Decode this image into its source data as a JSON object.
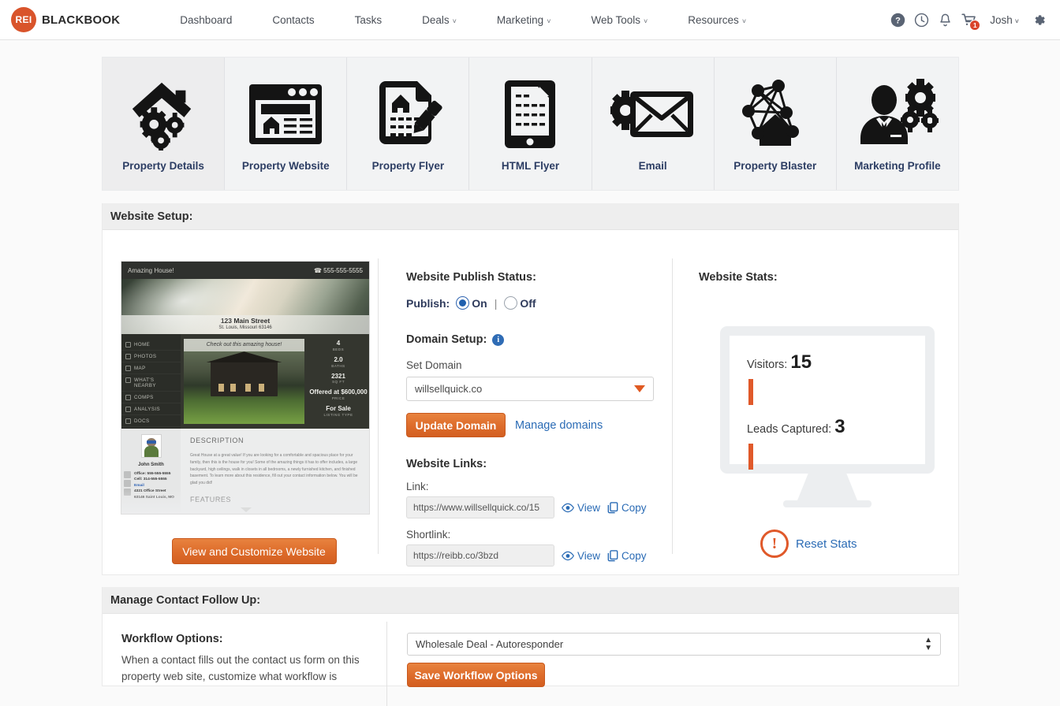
{
  "brand": {
    "badge": "REI",
    "name": "BLACKBOOK",
    "badge_color": "#d9542b"
  },
  "nav": {
    "links": [
      {
        "label": "Dashboard",
        "caret": ""
      },
      {
        "label": "Contacts",
        "caret": ""
      },
      {
        "label": "Tasks",
        "caret": ""
      },
      {
        "label": "Deals",
        "caret": "˅"
      },
      {
        "label": "Marketing",
        "caret": "˅"
      },
      {
        "label": "Web Tools",
        "caret": "˅"
      },
      {
        "label": "Resources",
        "caret": "˅"
      }
    ],
    "icons": [
      "help-icon",
      "history-clock-icon",
      "notification-bell-icon",
      "shopping-cart-icon",
      "settings-gear-icon"
    ],
    "cart_count": "1",
    "user": "Josh",
    "user_caret": "˅"
  },
  "tabs": [
    {
      "label": "Property Details",
      "icon": "house-gears-icon"
    },
    {
      "label": "Property Website",
      "icon": "browser-window-icon"
    },
    {
      "label": "Property Flyer",
      "icon": "document-pencil-icon"
    },
    {
      "label": "HTML Flyer",
      "icon": "tablet-document-icon"
    },
    {
      "label": "Email",
      "icon": "envelope-gear-icon"
    },
    {
      "label": "Property Blaster",
      "icon": "network-house-icon"
    },
    {
      "label": "Marketing Profile",
      "icon": "person-gears-icon"
    }
  ],
  "setup": {
    "section_title": "Website Setup:",
    "preview": {
      "header_title": "Amazing House!",
      "header_phone": "555-555-5555",
      "address_line1": "123 Main Street",
      "address_line2": "St. Louis, Missouri 63146",
      "photo_caption": "Check out this amazing house!",
      "nav_items": [
        "HOME",
        "PHOTOS",
        "MAP",
        "WHAT'S NEARBY",
        "COMPS",
        "ANALYSIS",
        "DOCS"
      ],
      "stats": [
        {
          "value": "4",
          "label": "BEDS"
        },
        {
          "value": "2.0",
          "label": "BATHS"
        },
        {
          "value": "2321",
          "label": "SQ FT"
        },
        {
          "value": "Offered at $600,000",
          "label": "PRICE"
        },
        {
          "value": "For Sale",
          "label": "LISTING TYPE"
        }
      ],
      "agent_name": "John Smith",
      "agent_office": "Office: 555-555-5555",
      "agent_cell": "Cell: 314-555-5555",
      "agent_email": "Email",
      "agent_street": "4321 Office Street",
      "agent_city": "63146 Saint Louis, MO",
      "description_heading": "DESCRIPTION",
      "description_body": "Great House at a great value! If you are looking for a comfortable and spacious place for your family, then this is the house for you! Some of the amazing things it has to offer includes, a large backyard, high ceilings, walk in closets in all bedrooms, a newly furnished kitchen, and finished basement. To learn more about this residence, fill out your contact information below. You will be glad you did!",
      "features_heading": "FEATURES"
    },
    "view_button": "View and Customize Website",
    "publish": {
      "title": "Website Publish Status:",
      "label": "Publish:",
      "on_label": "On",
      "off_label": "Off",
      "separator": "|",
      "selected": "On"
    },
    "domain": {
      "title": "Domain Setup:",
      "info_icon_char": "i",
      "set_domain_label": "Set Domain",
      "value": "willsellquick.co",
      "update_button": "Update Domain",
      "manage_link": "Manage domains"
    },
    "links": {
      "title": "Website Links:",
      "link_label": "Link:",
      "link_value": "https://www.willsellquick.co/15",
      "shortlink_label": "Shortlink:",
      "shortlink_value": "https://reibb.co/3bzd",
      "view_label": "View",
      "copy_label": "Copy"
    },
    "stats": {
      "title": "Website Stats:",
      "visitors_label": "Visitors:",
      "visitors_value": "15",
      "leads_label": "Leads Captured:",
      "leads_value": "3",
      "reset_label": "Reset Stats",
      "reset_icon_char": "!"
    }
  },
  "follow_up": {
    "section_title": "Manage Contact Follow Up:",
    "workflow_title": "Workflow Options:",
    "workflow_desc": "When a contact fills out the contact us form on this property web site, customize what workflow is",
    "select_value": "Wholesale Deal - Autoresponder",
    "save_button": "Save Workflow Options"
  },
  "colors": {
    "orange": "#dd6b2a",
    "blue_link": "#2a6bb5",
    "nav_label": "#2c3d63",
    "badge_red": "#d9442b"
  }
}
